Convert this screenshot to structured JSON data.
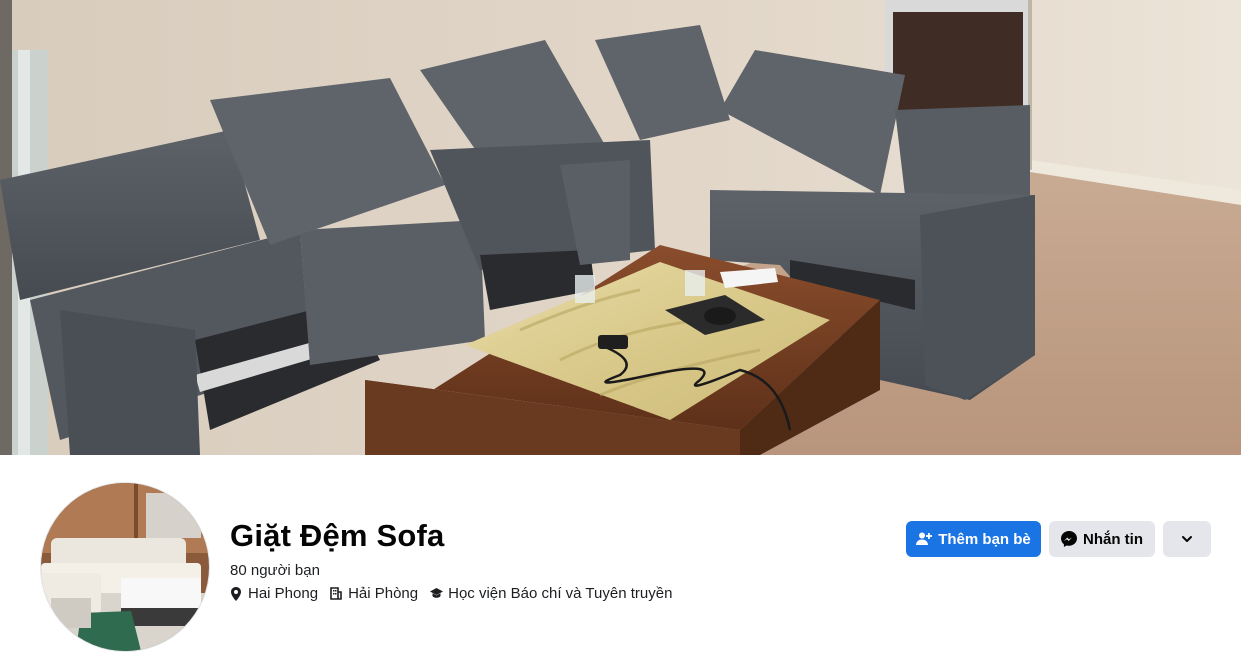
{
  "profile": {
    "name": "Giặt Đệm Sofa",
    "friends_count": "80 người bạn",
    "details": [
      {
        "icon": "location-pin-icon",
        "text": "Hai Phong"
      },
      {
        "icon": "building-icon",
        "text": "Hải Phòng"
      },
      {
        "icon": "graduation-cap-icon",
        "text": "Học viện Báo chí và Tuyên truyền"
      }
    ]
  },
  "actions": {
    "add_friend_label": "Thêm bạn bè",
    "message_label": "Nhắn tin"
  },
  "colors": {
    "primary_button": "#1b74e4",
    "secondary_button": "#e4e6eb",
    "text": "#050505"
  }
}
